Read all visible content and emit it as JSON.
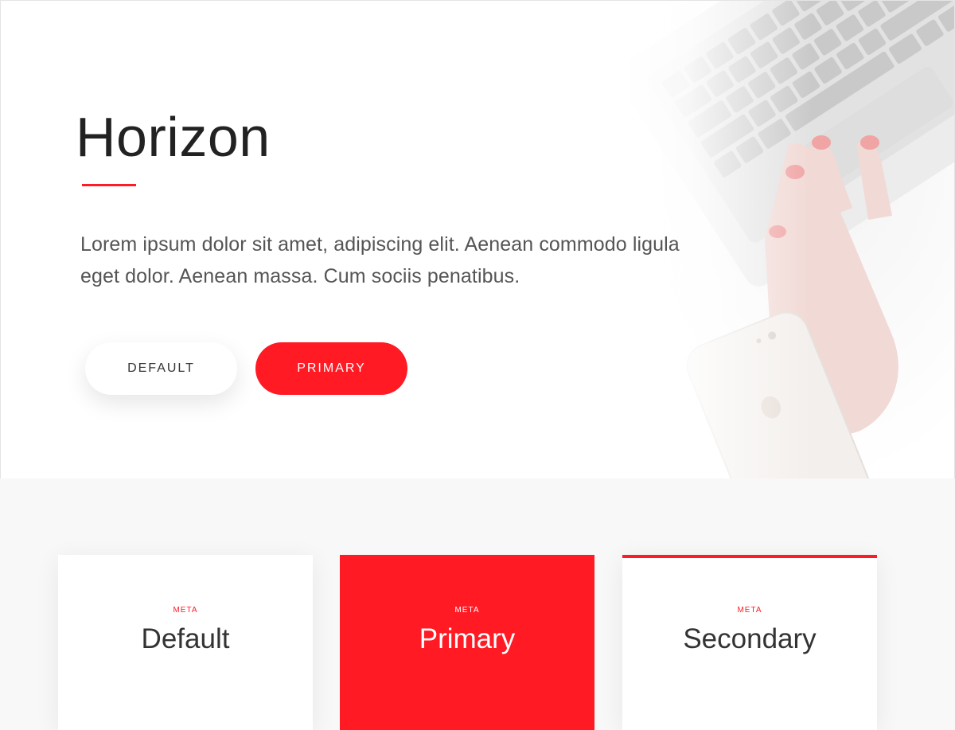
{
  "hero": {
    "title": "Horizon",
    "text": "Lorem ipsum dolor sit amet, adipiscing elit. Aenean commodo ligula eget dolor. Aenean massa. Cum sociis penatibus.",
    "buttons": {
      "default_label": "DEFAULT",
      "primary_label": "PRIMARY"
    },
    "image_subject": "laptop-keyboard-hand-phone-photo"
  },
  "cards": [
    {
      "meta": "META",
      "title": "Default"
    },
    {
      "meta": "META",
      "title": "Primary"
    },
    {
      "meta": "META",
      "title": "Secondary"
    }
  ],
  "colors": {
    "accent": "#ff1a24",
    "background": "#f8f8f8",
    "surface": "#ffffff",
    "text": "#222222"
  }
}
